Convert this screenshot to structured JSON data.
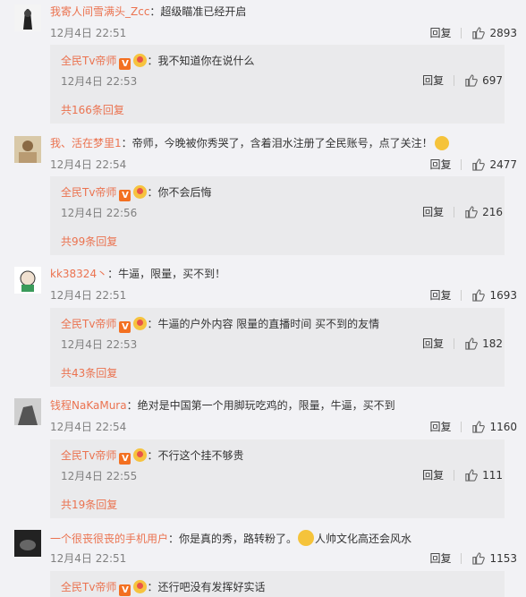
{
  "comments": [
    {
      "user": "我寄人间雪满头_Zcc",
      "text": "：超级瞄准已经开启",
      "time": "12月4日 22:51",
      "reply_label": "回复",
      "likes": "2893",
      "reply": {
        "user": "全民Tv帝师",
        "text": "：我不知道你在说什么",
        "time": "12月4日 22:53",
        "reply_label": "回复",
        "likes": "697"
      },
      "more": "共166条回复"
    },
    {
      "user": "我、活在梦里1",
      "text": "：帝师，今晚被你秀哭了，含着泪水注册了全民账号，点了关注！",
      "time": "12月4日 22:54",
      "reply_label": "回复",
      "likes": "2477",
      "reply": {
        "user": "全民Tv帝师",
        "text": "：你不会后悔",
        "time": "12月4日 22:56",
        "reply_label": "回复",
        "likes": "216"
      },
      "more": "共99条回复"
    },
    {
      "user": "kk38324丶",
      "text": "：牛逼，限量，买不到！",
      "time": "12月4日 22:51",
      "reply_label": "回复",
      "likes": "1693",
      "reply": {
        "user": "全民Tv帝师",
        "text": "：牛逼的户外内容 限量的直播时间 买不到的友情",
        "time": "12月4日 22:53",
        "reply_label": "回复",
        "likes": "182"
      },
      "more": "共43条回复"
    },
    {
      "user": "钱程NaKaMura",
      "text": "：绝对是中国第一个用脚玩吃鸡的，限量，牛逼，买不到",
      "time": "12月4日 22:54",
      "reply_label": "回复",
      "likes": "1160",
      "reply": {
        "user": "全民Tv帝师",
        "text": "：不行这个挂不够贵",
        "time": "12月4日 22:55",
        "reply_label": "回复",
        "likes": "111"
      },
      "more": "共19条回复"
    },
    {
      "user": "一个很丧很丧的手机用户",
      "text": "：你是真的秀，路转粉了。",
      "text_after_emoji": "人帅文化高还会风水",
      "time": "12月4日 22:51",
      "reply_label": "回复",
      "likes": "1153",
      "reply": {
        "user": "全民Tv帝师",
        "text": "：还行吧没有发挥好实话"
      }
    }
  ],
  "icons": {
    "avatar": "avatar",
    "thumb": "thumbs-up-icon",
    "verified": "verified-v-badge",
    "member": "member-badge"
  },
  "colors": {
    "username": "#eb7350",
    "timestamp": "#808080",
    "reply_bg": "#eaeaec",
    "page_bg": "#f2f2f5"
  }
}
